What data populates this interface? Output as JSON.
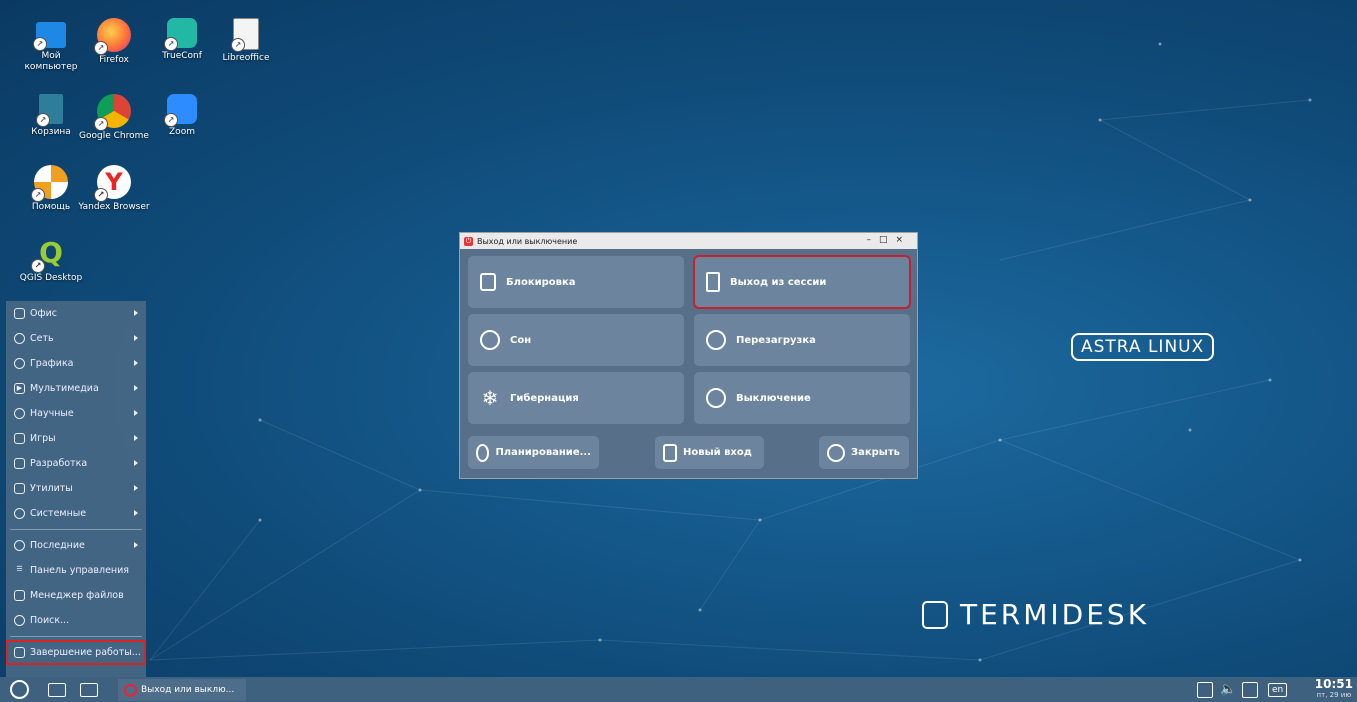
{
  "desktop_icons": [
    {
      "label": "Мой компьютер",
      "icon": "computer-icon",
      "color": "#1e88e5"
    },
    {
      "label": "Firefox",
      "icon": "firefox-icon",
      "color": "#ff7139"
    },
    {
      "label": "TrueConf",
      "icon": "trueconf-icon",
      "color": "#23b8a6"
    },
    {
      "label": "Libreoffice",
      "icon": "libreoffice-icon",
      "color": "#f0f0f0"
    },
    {
      "label": "Корзина",
      "icon": "trash-icon",
      "color": "#2e7d9a"
    },
    {
      "label": "Google Chrome",
      "icon": "chrome-icon",
      "color": "#db4437"
    },
    {
      "label": "Zoom",
      "icon": "zoom-icon",
      "color": "#2d8cff"
    },
    {
      "label": "Помощь",
      "icon": "help-icon",
      "color": "#f0a020"
    },
    {
      "label": "Yandex Browser",
      "icon": "yandex-browser-icon",
      "color": "#ffffff"
    },
    {
      "label": "QGIS Desktop",
      "icon": "qgis-icon",
      "color": "#589632"
    }
  ],
  "start_menu": {
    "categories": [
      {
        "label": "Офис",
        "icon": "office-icon"
      },
      {
        "label": "Сеть",
        "icon": "network-icon"
      },
      {
        "label": "Графика",
        "icon": "graphics-icon"
      },
      {
        "label": "Мультимедиа",
        "icon": "multimedia-icon"
      },
      {
        "label": "Научные",
        "icon": "science-icon"
      },
      {
        "label": "Игры",
        "icon": "games-icon"
      },
      {
        "label": "Разработка",
        "icon": "development-icon"
      },
      {
        "label": "Утилиты",
        "icon": "utilities-icon"
      },
      {
        "label": "Системные",
        "icon": "system-icon"
      }
    ],
    "recent": "Последние",
    "control_panel": "Панель управления",
    "file_manager": "Менеджер файлов",
    "search": "Поиск...",
    "shutdown": "Завершение работы..."
  },
  "dialog": {
    "title": "Выход или выключение",
    "lock": "Блокировка",
    "logout": "Выход из сессии",
    "sleep": "Сон",
    "reboot": "Перезагрузка",
    "hibernate": "Гибернация",
    "poweroff": "Выключение",
    "schedule": "Планирование...",
    "new_login": "Новый вход",
    "close": "Закрыть",
    "selected": "logout"
  },
  "taskbar": {
    "task_label": "Выход или выклю...",
    "lang": "en",
    "time": "10:51",
    "date": "пт, 29 ию"
  },
  "branding": {
    "astra": "ASTRA LINUX",
    "termidesk": "TERMIDESK"
  }
}
